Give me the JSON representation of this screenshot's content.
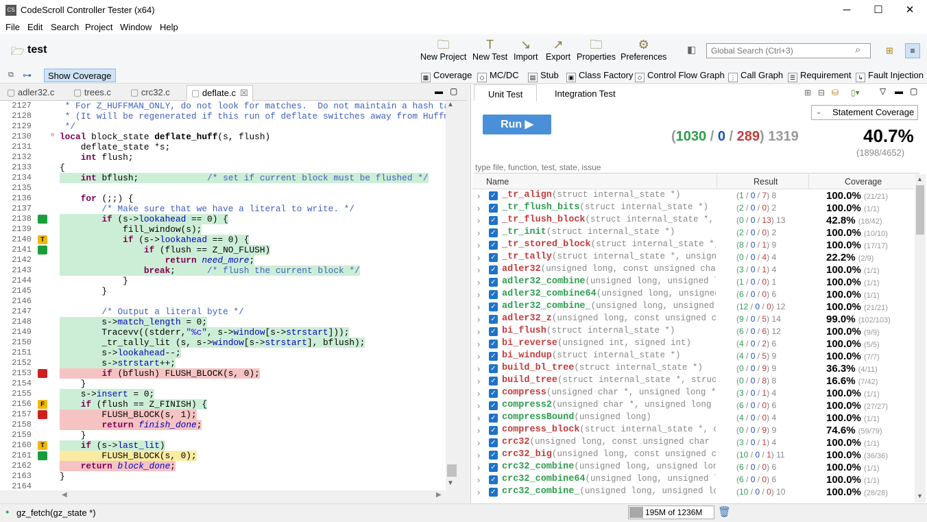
{
  "window": {
    "title": "CodeScroll Controller Tester (x64)",
    "minimize": "─",
    "maximize": "☐",
    "close": "✕"
  },
  "menu": [
    "File",
    "Edit",
    "Search",
    "Project",
    "Window",
    "Help"
  ],
  "project": "test",
  "toolbar": [
    "New Project",
    "New Test",
    "Import",
    "Export",
    "Properties",
    "Preferences"
  ],
  "global_search_placeholder": "Global Search (Ctrl+3)",
  "show_coverage": "Show Coverage",
  "toolbar2": [
    "Coverage",
    "MC/DC",
    "Stub",
    "Class Factory",
    "Control Flow Graph",
    "Call Graph",
    "Requirement",
    "Fault Injection"
  ],
  "editor_tabs": [
    "adler32.c",
    "trees.c",
    "crc32.c",
    "deflate.c"
  ],
  "code_lines": [
    {
      "n": "2127",
      "t": " * For Z_HUFFMAN_ONLY, do not look for matches.  Do not maintain a hash table.",
      "c": "cm",
      "h": "",
      "m": ""
    },
    {
      "n": "2128",
      "t": " * (It will be regenerated if this run of deflate switches away from Huffman.)",
      "c": "cm",
      "h": "",
      "m": ""
    },
    {
      "n": "2129",
      "t": " */",
      "c": "cm",
      "h": "",
      "m": ""
    },
    {
      "n": "2130",
      "t": "local block_state deflate_huff(s, flush)",
      "c": "",
      "h": "",
      "m": ""
    },
    {
      "n": "2131",
      "t": "    deflate_state *s;",
      "c": "",
      "h": "",
      "m": ""
    },
    {
      "n": "2132",
      "t": "    int flush;",
      "c": "",
      "h": "",
      "m": ""
    },
    {
      "n": "2133",
      "t": "{",
      "c": "",
      "h": "",
      "m": ""
    },
    {
      "n": "2134",
      "t": "    int bflush;             /* set if current block must be flushed */",
      "c": "",
      "h": "g",
      "m": ""
    },
    {
      "n": "2135",
      "t": "",
      "c": "",
      "h": "",
      "m": ""
    },
    {
      "n": "2136",
      "t": "    for (;;) {",
      "c": "",
      "h": "",
      "m": ""
    },
    {
      "n": "2137",
      "t": "        /* Make sure that we have a literal to write. */",
      "c": "cm",
      "h": "",
      "m": ""
    },
    {
      "n": "2138",
      "t": "        if (s->lookahead == 0) {",
      "c": "",
      "h": "g",
      "m": "G"
    },
    {
      "n": "2139",
      "t": "            fill_window(s);",
      "c": "",
      "h": "g",
      "m": ""
    },
    {
      "n": "2140",
      "t": "            if (s->lookahead == 0) {",
      "c": "",
      "h": "g",
      "m": "T"
    },
    {
      "n": "2141",
      "t": "                if (flush == Z_NO_FLUSH)",
      "c": "",
      "h": "g",
      "m": "G"
    },
    {
      "n": "2142",
      "t": "                    return need_more;",
      "c": "",
      "h": "g",
      "m": ""
    },
    {
      "n": "2143",
      "t": "                break;      /* flush the current block */",
      "c": "",
      "h": "g",
      "m": ""
    },
    {
      "n": "2144",
      "t": "            }",
      "c": "",
      "h": "",
      "m": ""
    },
    {
      "n": "2145",
      "t": "        }",
      "c": "",
      "h": "",
      "m": ""
    },
    {
      "n": "2146",
      "t": "",
      "c": "",
      "h": "",
      "m": ""
    },
    {
      "n": "2147",
      "t": "        /* Output a literal byte */",
      "c": "cm",
      "h": "",
      "m": ""
    },
    {
      "n": "2148",
      "t": "        s->match_length = 0;",
      "c": "",
      "h": "g",
      "m": ""
    },
    {
      "n": "2149",
      "t": "        Tracevv((stderr,\"%c\", s->window[s->strstart]));",
      "c": "",
      "h": "g",
      "m": ""
    },
    {
      "n": "2150",
      "t": "        _tr_tally_lit (s, s->window[s->strstart], bflush);",
      "c": "",
      "h": "g",
      "m": ""
    },
    {
      "n": "2151",
      "t": "        s->lookahead--;",
      "c": "",
      "h": "g",
      "m": ""
    },
    {
      "n": "2152",
      "t": "        s->strstart++;",
      "c": "",
      "h": "g",
      "m": ""
    },
    {
      "n": "2153",
      "t": "        if (bflush) FLUSH_BLOCK(s, 0);",
      "c": "",
      "h": "r",
      "m": "R"
    },
    {
      "n": "2154",
      "t": "    }",
      "c": "",
      "h": "",
      "m": ""
    },
    {
      "n": "2155",
      "t": "    s->insert = 0;",
      "c": "",
      "h": "g",
      "m": ""
    },
    {
      "n": "2156",
      "t": "    if (flush == Z_FINISH) {",
      "c": "",
      "h": "g",
      "m": "F"
    },
    {
      "n": "2157",
      "t": "        FLUSH_BLOCK(s, 1);",
      "c": "",
      "h": "r",
      "m": "R"
    },
    {
      "n": "2158",
      "t": "        return finish_done;",
      "c": "",
      "h": "r",
      "m": ""
    },
    {
      "n": "2159",
      "t": "    }",
      "c": "",
      "h": "",
      "m": ""
    },
    {
      "n": "2160",
      "t": "    if (s->last_lit)",
      "c": "",
      "h": "g",
      "m": "T"
    },
    {
      "n": "2161",
      "t": "        FLUSH_BLOCK(s, 0);",
      "c": "",
      "h": "y",
      "m": "G"
    },
    {
      "n": "2162",
      "t": "    return block_done;",
      "c": "",
      "h": "r",
      "m": ""
    },
    {
      "n": "2163",
      "t": "}",
      "c": "",
      "h": "",
      "m": ""
    },
    {
      "n": "2164",
      "t": "",
      "c": "",
      "h": "",
      "m": ""
    }
  ],
  "right_tabs": [
    "Unit Test",
    "Integration  Test"
  ],
  "run_label": "Run",
  "coverage_type": "Statement Coverage",
  "summary": {
    "pass": "1030",
    "fail": "0",
    "error": "289",
    "total": "1319",
    "percent": "40.7%",
    "ratio": "(1898/4652)"
  },
  "filter_placeholder": "type file, function, test, state, issue",
  "columns": [
    "Name",
    "Result",
    "Coverage"
  ],
  "rows": [
    {
      "fn": "_tr_align",
      "sig": "(struct internal_state *)",
      "p": "1",
      "f": "0",
      "e": "7",
      "t": "8",
      "cov": "100.0%",
      "r": "(21/21)",
      "st": "r"
    },
    {
      "fn": "_tr_flush_bits",
      "sig": "(struct internal_state *)",
      "p": "2",
      "f": "0",
      "e": "0",
      "t": "2",
      "cov": "100.0%",
      "r": "(1/1)",
      "st": "g"
    },
    {
      "fn": "_tr_flush_block",
      "sig": "(struct internal_state *, ch",
      "p": "0",
      "f": "0",
      "e": "13",
      "t": "13",
      "cov": "42.8%",
      "r": "(18/42)",
      "st": "r"
    },
    {
      "fn": "_tr_init",
      "sig": "(struct internal_state *)",
      "p": "2",
      "f": "0",
      "e": "0",
      "t": "2",
      "cov": "100.0%",
      "r": "(10/10)",
      "st": "g"
    },
    {
      "fn": "_tr_stored_block",
      "sig": "(struct internal_state *, c",
      "p": "8",
      "f": "0",
      "e": "1",
      "t": "9",
      "cov": "100.0%",
      "r": "(17/17)",
      "st": "r"
    },
    {
      "fn": "_tr_tally",
      "sig": "(struct internal_state *, unsigned",
      "p": "0",
      "f": "0",
      "e": "4",
      "t": "4",
      "cov": "22.2%",
      "r": "(2/9)",
      "st": "r"
    },
    {
      "fn": "adler32",
      "sig": "(unsigned long, const unsigned char *",
      "p": "3",
      "f": "0",
      "e": "1",
      "t": "4",
      "cov": "100.0%",
      "r": "(1/1)",
      "st": "r"
    },
    {
      "fn": "adler32_combine",
      "sig": "(unsigned long, unsigned lon",
      "p": "1",
      "f": "0",
      "e": "0",
      "t": "1",
      "cov": "100.0%",
      "r": "(1/1)",
      "st": "g"
    },
    {
      "fn": "adler32_combine64",
      "sig": "(unsigned long, unsigned",
      "p": "6",
      "f": "0",
      "e": "0",
      "t": "6",
      "cov": "100.0%",
      "r": "(1/1)",
      "st": "g"
    },
    {
      "fn": "adler32_combine_",
      "sig": "(unsigned long, unsigned lo",
      "p": "12",
      "f": "0",
      "e": "0",
      "t": "12",
      "cov": "100.0%",
      "r": "(21/21)",
      "st": "g"
    },
    {
      "fn": "adler32_z",
      "sig": "(unsigned long, const unsigned char",
      "p": "9",
      "f": "0",
      "e": "5",
      "t": "14",
      "cov": "99.0%",
      "r": "(102/103)",
      "st": "r"
    },
    {
      "fn": "bi_flush",
      "sig": "(struct internal_state *)",
      "p": "6",
      "f": "0",
      "e": "6",
      "t": "12",
      "cov": "100.0%",
      "r": "(9/9)",
      "st": "r"
    },
    {
      "fn": "bi_reverse",
      "sig": "(unsigned int, signed int)",
      "p": "4",
      "f": "0",
      "e": "2",
      "t": "6",
      "cov": "100.0%",
      "r": "(5/5)",
      "st": "r"
    },
    {
      "fn": "bi_windup",
      "sig": "(struct internal_state *)",
      "p": "4",
      "f": "0",
      "e": "5",
      "t": "9",
      "cov": "100.0%",
      "r": "(7/7)",
      "st": "r"
    },
    {
      "fn": "build_bl_tree",
      "sig": "(struct internal_state *)",
      "p": "0",
      "f": "0",
      "e": "9",
      "t": "9",
      "cov": "36.3%",
      "r": "(4/11)",
      "st": "r"
    },
    {
      "fn": "build_tree",
      "sig": "(struct internal_state *, struct",
      "p": "0",
      "f": "0",
      "e": "8",
      "t": "8",
      "cov": "16.6%",
      "r": "(7/42)",
      "st": "r"
    },
    {
      "fn": "compress",
      "sig": "(unsigned char *, unsigned long *...",
      "p": "3",
      "f": "0",
      "e": "1",
      "t": "4",
      "cov": "100.0%",
      "r": "(1/1)",
      "st": "r"
    },
    {
      "fn": "compress2",
      "sig": "(unsigned char *, unsigned long *",
      "p": "6",
      "f": "0",
      "e": "0",
      "t": "6",
      "cov": "100.0%",
      "r": "(27/27)",
      "st": "g"
    },
    {
      "fn": "compressBound",
      "sig": "(unsigned long)",
      "p": "4",
      "f": "0",
      "e": "0",
      "t": "4",
      "cov": "100.0%",
      "r": "(1/1)",
      "st": "g"
    },
    {
      "fn": "compress_block",
      "sig": "(struct internal_state *, cor",
      "p": "0",
      "f": "0",
      "e": "9",
      "t": "9",
      "cov": "74.6%",
      "r": "(59/79)",
      "st": "r"
    },
    {
      "fn": "crc32",
      "sig": "(unsigned long, const unsigned char *...",
      "p": "3",
      "f": "0",
      "e": "1",
      "t": "4",
      "cov": "100.0%",
      "r": "(1/1)",
      "st": "r"
    },
    {
      "fn": "crc32_big",
      "sig": "(unsigned long, const unsigned char",
      "p": "10",
      "f": "0",
      "e": "1",
      "t": "11",
      "cov": "100.0%",
      "r": "(36/36)",
      "st": "r"
    },
    {
      "fn": "crc32_combine",
      "sig": "(unsigned long, unsigned long.",
      "p": "6",
      "f": "0",
      "e": "0",
      "t": "6",
      "cov": "100.0%",
      "r": "(1/1)",
      "st": "g"
    },
    {
      "fn": "crc32_combine64",
      "sig": "(unsigned long, unsigned lon",
      "p": "6",
      "f": "0",
      "e": "0",
      "t": "6",
      "cov": "100.0%",
      "r": "(1/1)",
      "st": "g"
    },
    {
      "fn": "crc32_combine_",
      "sig": "(unsigned long, unsigned long",
      "p": "10",
      "f": "0",
      "e": "0",
      "t": "10",
      "cov": "100.0%",
      "r": "(28/28)",
      "st": "g"
    }
  ],
  "status": {
    "function": "gz_fetch(gz_state *)",
    "memory": "195M of 1236M"
  },
  "colors": {
    "pass": "#2e9d4e",
    "fail": "#1f4fbf",
    "error": "#c43b3b",
    "accent": "#4a90d9"
  }
}
